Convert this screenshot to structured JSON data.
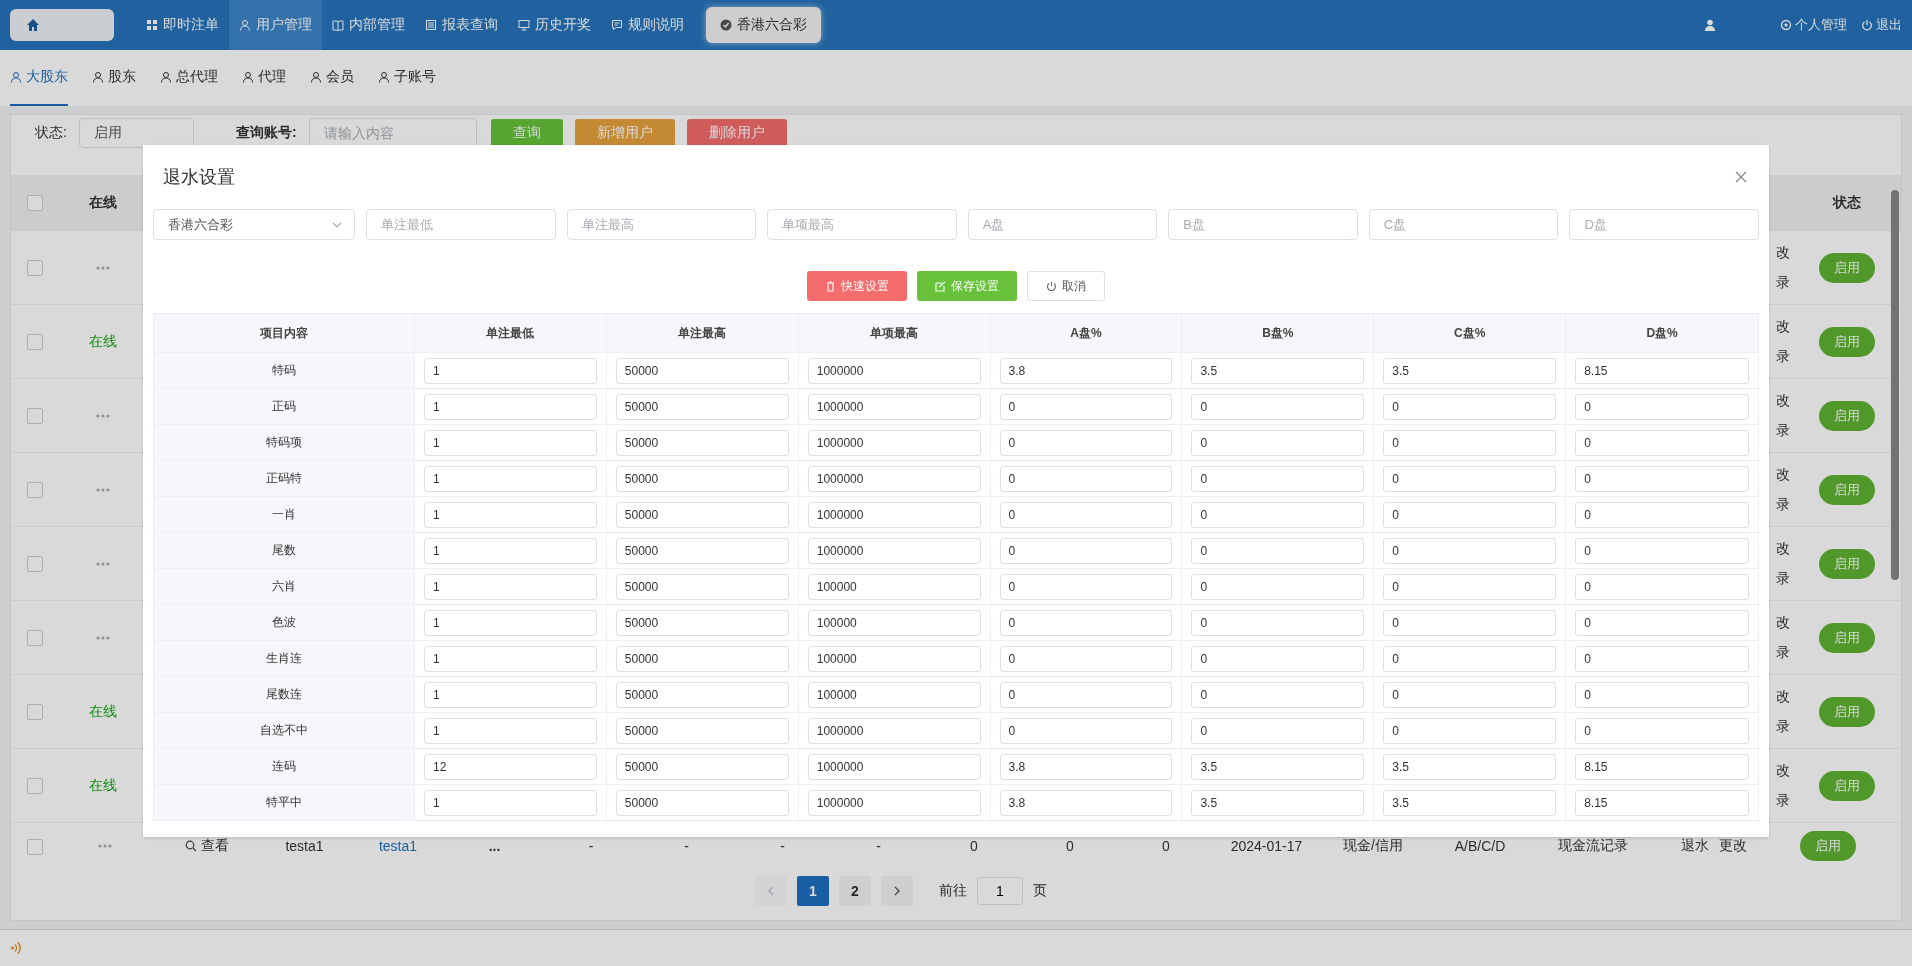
{
  "nav": {
    "items": [
      {
        "label": "即时注单",
        "selected": false
      },
      {
        "label": "用户管理",
        "selected": true
      },
      {
        "label": "内部管理",
        "selected": false
      },
      {
        "label": "报表查询",
        "selected": false
      },
      {
        "label": "历史开奖",
        "selected": false
      },
      {
        "label": "规则说明",
        "selected": false
      }
    ],
    "game_tab": "香港六合彩",
    "user_menu": "个人管理",
    "logout": "退出"
  },
  "sub_tabs": [
    {
      "label": "大股东",
      "selected": true
    },
    {
      "label": "股东",
      "selected": false
    },
    {
      "label": "总代理",
      "selected": false
    },
    {
      "label": "代理",
      "selected": false
    },
    {
      "label": "会员",
      "selected": false
    },
    {
      "label": "子账号",
      "selected": false
    }
  ],
  "filters": {
    "status_label": "状态:",
    "status_value": "启用",
    "account_label": "查询账号:",
    "account_placeholder": "请输入内容",
    "buttons": [
      {
        "label": "查询",
        "kind": "search"
      },
      {
        "label": "新增用户",
        "kind": "add"
      },
      {
        "label": "删除用户",
        "kind": "delete"
      }
    ]
  },
  "user_table": {
    "header": {
      "all_checked": false,
      "online": "在线",
      "status": "状态"
    },
    "rows": [
      {
        "checked": false,
        "online": false,
        "ops_fragments": [
          "改",
          "录"
        ],
        "status": "启用"
      },
      {
        "checked": false,
        "online": true,
        "online_label": "在线",
        "ops_fragments": [
          "改",
          "录"
        ],
        "status": "启用"
      },
      {
        "checked": false,
        "online": false,
        "ops_fragments": [
          "改",
          "录"
        ],
        "status": "启用"
      },
      {
        "checked": false,
        "online": false,
        "ops_fragments": [
          "改",
          "录"
        ],
        "status": "启用"
      },
      {
        "checked": false,
        "online": false,
        "ops_fragments": [
          "改",
          "录"
        ],
        "status": "启用"
      },
      {
        "checked": false,
        "online": false,
        "ops_fragments": [
          "改",
          "录"
        ],
        "status": "启用"
      },
      {
        "checked": false,
        "online": true,
        "online_label": "在线",
        "ops_fragments": [
          "改",
          "录"
        ],
        "status": "启用"
      },
      {
        "checked": false,
        "online": true,
        "online_label": "在线",
        "ops_fragments": [
          "改",
          "录"
        ],
        "status": "启用"
      }
    ],
    "last_row": {
      "checked": false,
      "online": false,
      "view": "查看",
      "account": "testa1",
      "name": "testa1",
      "column_4": "...",
      "dashes": [
        "-",
        "-",
        "-",
        "-"
      ],
      "numbers": [
        "0",
        "0",
        "0"
      ],
      "date": "2024-01-17",
      "type": "现金/信用",
      "plates": "A/B/C/D",
      "cash_log": "现金流记录",
      "rebate": "退水",
      "modify": "更改",
      "status": "启用"
    }
  },
  "pagination": {
    "prev_disabled": true,
    "pages": [
      {
        "label": "1",
        "selected": true
      },
      {
        "label": "2",
        "selected": false
      }
    ],
    "goto_label": "前往",
    "goto_value": "1",
    "page_unit": "页"
  },
  "dialog": {
    "title": "退水设置",
    "fields": [
      {
        "kind": "select",
        "value": "香港六合彩"
      },
      {
        "kind": "input",
        "placeholder": "单注最低"
      },
      {
        "kind": "input",
        "placeholder": "单注最高"
      },
      {
        "kind": "input",
        "placeholder": "单项最高"
      },
      {
        "kind": "input",
        "placeholder": "A盘"
      },
      {
        "kind": "input",
        "placeholder": "B盘"
      },
      {
        "kind": "input",
        "placeholder": "C盘"
      },
      {
        "kind": "input",
        "placeholder": "D盘"
      }
    ],
    "buttons": [
      {
        "label": "快速设置",
        "kind": "quick"
      },
      {
        "label": "保存设置",
        "kind": "save"
      },
      {
        "label": "取消",
        "kind": "cancel"
      }
    ],
    "columns": [
      "项目内容",
      "单注最低",
      "单注最高",
      "单项最高",
      "A盘%",
      "B盘%",
      "C盘%",
      "D盘%"
    ],
    "rows": [
      {
        "item": "特码",
        "values": [
          "1",
          "50000",
          "1000000",
          "3.8",
          "3.5",
          "3.5",
          "8.15"
        ]
      },
      {
        "item": "正码",
        "values": [
          "1",
          "50000",
          "1000000",
          "0",
          "0",
          "0",
          "0"
        ]
      },
      {
        "item": "特码项",
        "values": [
          "1",
          "50000",
          "1000000",
          "0",
          "0",
          "0",
          "0"
        ]
      },
      {
        "item": "正码特",
        "values": [
          "1",
          "50000",
          "1000000",
          "0",
          "0",
          "0",
          "0"
        ]
      },
      {
        "item": "一肖",
        "values": [
          "1",
          "50000",
          "1000000",
          "0",
          "0",
          "0",
          "0"
        ]
      },
      {
        "item": "尾数",
        "values": [
          "1",
          "50000",
          "1000000",
          "0",
          "0",
          "0",
          "0"
        ]
      },
      {
        "item": "六肖",
        "values": [
          "1",
          "50000",
          "100000",
          "0",
          "0",
          "0",
          "0"
        ]
      },
      {
        "item": "色波",
        "values": [
          "1",
          "50000",
          "100000",
          "0",
          "0",
          "0",
          "0"
        ]
      },
      {
        "item": "生肖连",
        "values": [
          "1",
          "50000",
          "100000",
          "0",
          "0",
          "0",
          "0"
        ]
      },
      {
        "item": "尾数连",
        "values": [
          "1",
          "50000",
          "100000",
          "0",
          "0",
          "0",
          "0"
        ]
      },
      {
        "item": "自选不中",
        "values": [
          "1",
          "50000",
          "1000000",
          "0",
          "0",
          "0",
          "0"
        ]
      },
      {
        "item": "连码",
        "values": [
          "12",
          "50000",
          "1000000",
          "3.8",
          "3.5",
          "3.5",
          "8.15"
        ]
      },
      {
        "item": "特平中",
        "values": [
          "1",
          "50000",
          "1000000",
          "3.8",
          "3.5",
          "3.5",
          "8.15"
        ]
      }
    ]
  }
}
